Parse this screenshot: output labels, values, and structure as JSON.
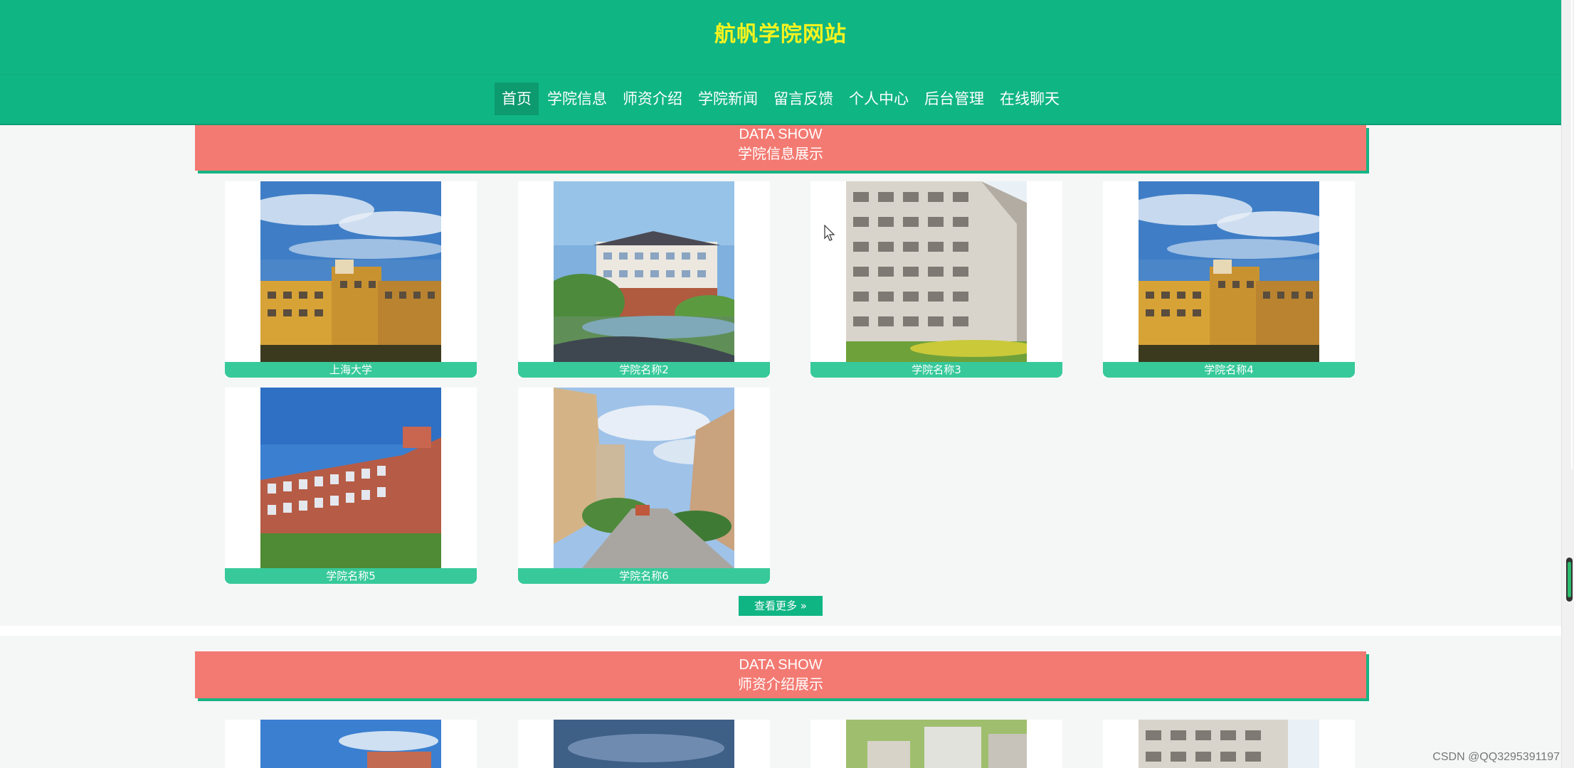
{
  "header": {
    "title": "航帆学院网站",
    "nav": [
      {
        "label": "首页",
        "active": true
      },
      {
        "label": "学院信息",
        "active": false
      },
      {
        "label": "师资介绍",
        "active": false
      },
      {
        "label": "学院新闻",
        "active": false
      },
      {
        "label": "留言反馈",
        "active": false
      },
      {
        "label": "个人中心",
        "active": false
      },
      {
        "label": "后台管理",
        "active": false
      },
      {
        "label": "在线聊天",
        "active": false
      }
    ]
  },
  "section1": {
    "banner_en": "DATA SHOW",
    "banner_cn": "学院信息展示",
    "cards": [
      {
        "caption": "上海大学",
        "image": "photo-building-yellow"
      },
      {
        "caption": "学院名称2",
        "image": "photo-campus-lake"
      },
      {
        "caption": "学院名称3",
        "image": "photo-dormitory-white"
      },
      {
        "caption": "学院名称4",
        "image": "photo-building-yellow"
      },
      {
        "caption": "学院名称5",
        "image": "photo-building-red"
      },
      {
        "caption": "学院名称6",
        "image": "photo-campus-street"
      }
    ],
    "more_label": "查看更多 »"
  },
  "section2": {
    "banner_en": "DATA SHOW",
    "banner_cn": "师资介绍展示"
  },
  "watermark": "CSDN @QQ3295391197",
  "colors": {
    "header_bg": "#10b584",
    "title": "#f6f31f",
    "banner": "#f37a72",
    "caption": "#37c99a"
  }
}
